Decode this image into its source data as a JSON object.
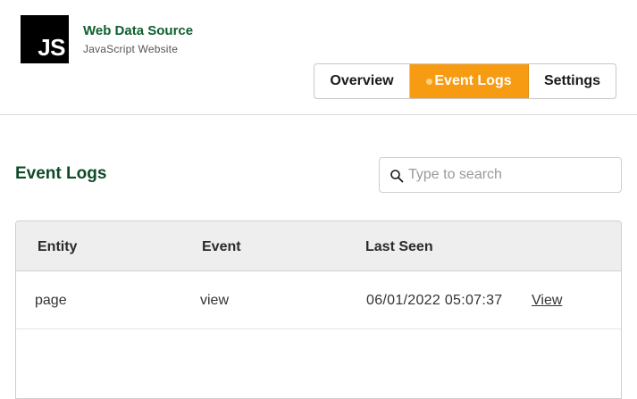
{
  "source": {
    "logo_text": "JS",
    "title": "Web Data Source",
    "subtitle": "JavaScript Website"
  },
  "tabs": [
    {
      "label": "Overview",
      "active": false
    },
    {
      "label": "Event Logs",
      "active": true
    },
    {
      "label": "Settings",
      "active": false
    }
  ],
  "section": {
    "title": "Event Logs"
  },
  "search": {
    "placeholder": "Type to search",
    "value": ""
  },
  "table": {
    "columns": [
      "Entity",
      "Event",
      "Last Seen"
    ],
    "rows": [
      {
        "entity": "page",
        "event": "view",
        "last_seen": "06/01/2022 05:07:37",
        "action": "View"
      }
    ]
  },
  "colors": {
    "brand_green": "#0f5e2f",
    "active_tab": "#f79b13"
  }
}
